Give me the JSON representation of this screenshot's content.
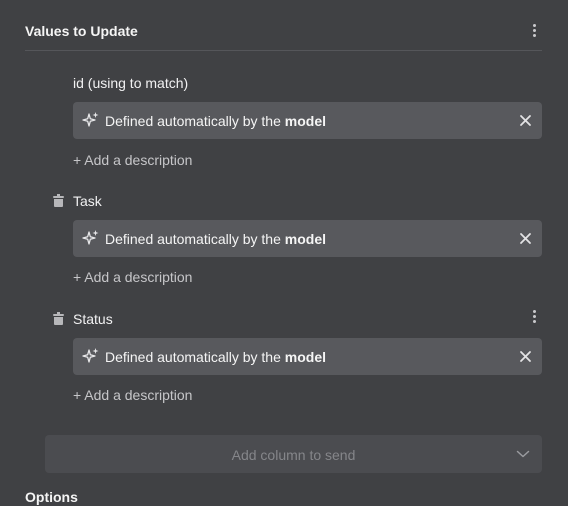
{
  "section": {
    "title": "Values to Update"
  },
  "fields": [
    {
      "label": "id (using to match)",
      "value_prefix": "Defined automatically by the ",
      "value_emphasis": "model",
      "add_description": "+ Add a description",
      "sparkle_icon": "sparkle-icon",
      "deletable": false
    },
    {
      "label": "Task",
      "value_prefix": "Defined automatically by the ",
      "value_emphasis": "model",
      "add_description": "+ Add a description",
      "sparkle_icon": "sparkle-icon",
      "deletable": true
    },
    {
      "label": "Status",
      "value_prefix": "Defined automatically by the ",
      "value_emphasis": "model",
      "add_description": "+ Add a description",
      "sparkle_icon": "sparkle-icon",
      "deletable": true
    }
  ],
  "add_column": {
    "placeholder": "Add column to send"
  },
  "options": {
    "title": "Options"
  },
  "colors": {
    "panel_bg": "#404144",
    "field_bg": "#58595d",
    "select_bg": "#4b4c50",
    "text_primary": "#f5f5f5",
    "text_muted": "#c6c6c9",
    "placeholder": "#85868a"
  }
}
